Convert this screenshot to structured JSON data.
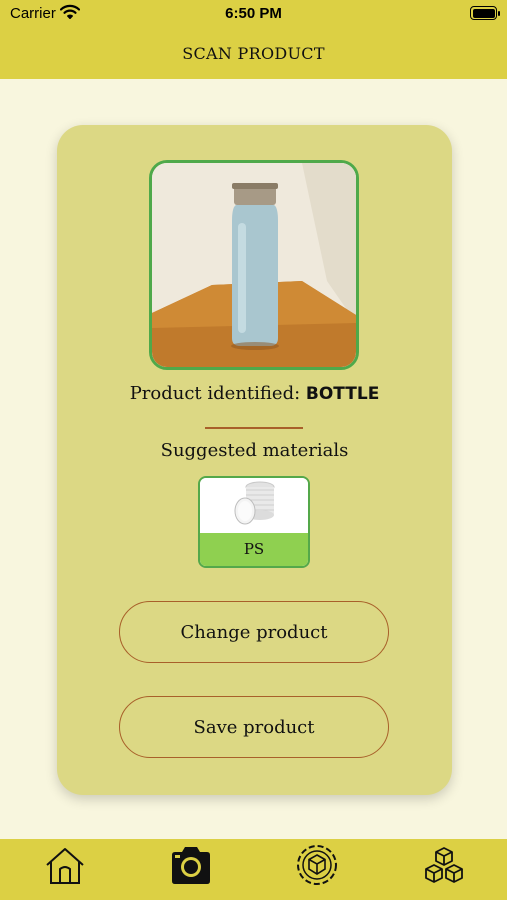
{
  "status_bar": {
    "carrier": "Carrier",
    "time": "6:50 PM"
  },
  "header": {
    "title": "SCAN PRODUCT"
  },
  "product": {
    "identified_prefix": "Product identified: ",
    "identified_name": "BOTTLE",
    "image_icon": "water-bottle-photo"
  },
  "materials": {
    "heading": "Suggested materials",
    "items": [
      {
        "label": "PS",
        "icon": "stacked-plastic-discs"
      }
    ]
  },
  "actions": {
    "change_label": "Change product",
    "save_label": "Save product"
  },
  "tab_bar": {
    "items": [
      {
        "name": "home",
        "icon": "home-icon",
        "active": false
      },
      {
        "name": "scan",
        "icon": "camera-icon",
        "active": true
      },
      {
        "name": "recycle",
        "icon": "recycle-cube-icon",
        "active": false
      },
      {
        "name": "materials",
        "icon": "boxes-icon",
        "active": false
      }
    ]
  },
  "colors": {
    "bar": "#dcd044",
    "card": "#dcd884",
    "background": "#f8f6de",
    "accent_green": "#4fa94a",
    "accent_brown": "#a8602a"
  }
}
